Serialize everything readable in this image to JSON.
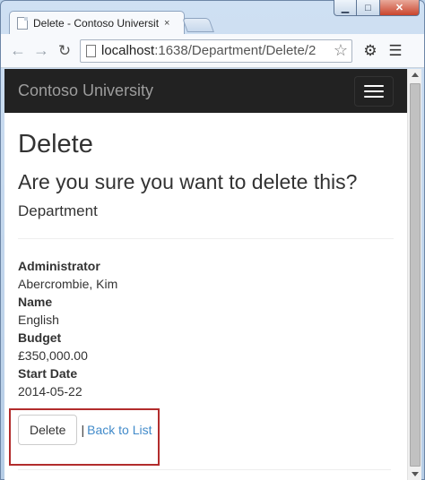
{
  "browser": {
    "tab_title": "Delete - Contoso Universit",
    "tab_close": "×",
    "url_host": "localhost",
    "url_path": ":1638/Department/Delete/2",
    "icons": {
      "back": "back-arrow-icon",
      "forward": "forward-arrow-icon",
      "reload": "reload-icon",
      "star": "star-icon",
      "settings": "gear-icon",
      "menu": "menu-icon"
    },
    "window_controls": {
      "minimize": "▁",
      "maximize": "□",
      "close": "✕"
    }
  },
  "site": {
    "brand": "Contoso University"
  },
  "page": {
    "title": "Delete",
    "question": "Are you sure you want to delete this?",
    "entity": "Department",
    "fields": [
      {
        "label": "Administrator",
        "value": "Abercrombie, Kim"
      },
      {
        "label": "Name",
        "value": "English"
      },
      {
        "label": "Budget",
        "value": "£350,000.00"
      },
      {
        "label": "Start Date",
        "value": "2014-05-22"
      }
    ],
    "delete_button": "Delete",
    "separator": "|",
    "back_link": "Back to List"
  },
  "colors": {
    "navbar": "#222222",
    "link": "#428bca",
    "highlight": "#b22c2c"
  }
}
